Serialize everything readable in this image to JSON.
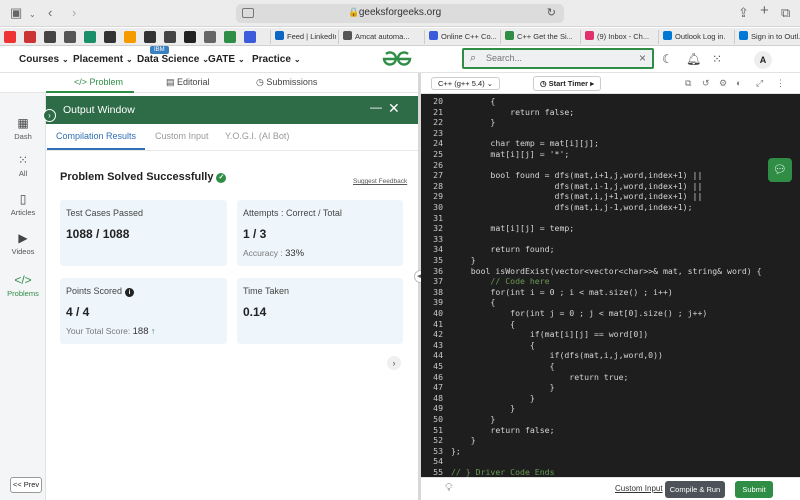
{
  "browser": {
    "url": "geeksforgeeks.org",
    "bookmarks": [
      {
        "label": "Feed | LinkedIn",
        "color": "#0a66c2"
      },
      {
        "label": "Amcat automa...",
        "color": "#555555"
      },
      {
        "label": "Online C++ Co...",
        "color": "#3b5bdb"
      },
      {
        "label": "C++ Get the Si...",
        "color": "#2f8d46"
      },
      {
        "label": "(9) Inbox - Ch...",
        "color": "#e1306c"
      },
      {
        "label": "Outlook Log in...",
        "color": "#0078d4"
      },
      {
        "label": "Sign in to Outl...",
        "color": "#0078d4"
      }
    ]
  },
  "header": {
    "nav": [
      {
        "label": "Courses"
      },
      {
        "label": "Placement"
      },
      {
        "label": "Data Science"
      },
      {
        "label": "GATE"
      },
      {
        "label": "Practice"
      }
    ],
    "badge": "IBM",
    "search_placeholder": "Search...",
    "avatar": "A"
  },
  "problem_tabs": {
    "problem": "Problem",
    "editorial": "Editorial",
    "submissions": "Submissions"
  },
  "sidebar": {
    "items": [
      {
        "label": "Dash"
      },
      {
        "label": "All"
      },
      {
        "label": "Articles"
      },
      {
        "label": "Videos"
      },
      {
        "label": "Problems"
      }
    ],
    "prev": "<< Prev"
  },
  "output": {
    "title": "Output Window",
    "tabs": [
      "Compilation Results",
      "Custom Input",
      "Y.O.G.I. (AI Bot)"
    ],
    "status": "Problem Solved Successfully",
    "suggest": "Suggest Feedback",
    "tests_label": "Test Cases Passed",
    "tests_value": "1088 / 1088",
    "attempts_label": "Attempts : Correct / Total",
    "attempts_value": "1 / 3",
    "accuracy_label": "Accuracy :",
    "accuracy_value": "33%",
    "points_label": "Points Scored",
    "points_value": "4 / 4",
    "total_label": "Your Total Score:",
    "total_value": "188",
    "time_label": "Time Taken",
    "time_value": "0.14"
  },
  "editor": {
    "language": "C++ (g++ 5.4)",
    "timer": "Start Timer",
    "custom_input": "Custom Input",
    "compile": "Compile & Run",
    "submit": "Submit",
    "lines": [
      {
        "n": "20",
        "t": "        {"
      },
      {
        "n": "21",
        "t": "            return false;"
      },
      {
        "n": "22",
        "t": "        }"
      },
      {
        "n": "23",
        "t": ""
      },
      {
        "n": "24",
        "t": "        char temp = mat[i][j];"
      },
      {
        "n": "25",
        "t": "        mat[i][j] = '*';"
      },
      {
        "n": "26",
        "t": ""
      },
      {
        "n": "27",
        "t": "        bool found = dfs(mat,i+1,j,word,index+1) ||"
      },
      {
        "n": "28",
        "t": "                     dfs(mat,i-1,j,word,index+1) ||"
      },
      {
        "n": "29",
        "t": "                     dfs(mat,i,j+1,word,index+1) ||"
      },
      {
        "n": "30",
        "t": "                     dfs(mat,i,j-1,word,index+1);"
      },
      {
        "n": "31",
        "t": ""
      },
      {
        "n": "32",
        "t": "        mat[i][j] = temp;"
      },
      {
        "n": "33",
        "t": ""
      },
      {
        "n": "34",
        "t": "        return found;"
      },
      {
        "n": "35",
        "t": "    }"
      },
      {
        "n": "36",
        "t": "    bool isWordExist(vector<vector<char>>& mat, string& word) {"
      },
      {
        "n": "37",
        "t": "        // Code here"
      },
      {
        "n": "38",
        "t": "        for(int i = 0 ; i < mat.size() ; i++)"
      },
      {
        "n": "39",
        "t": "        {"
      },
      {
        "n": "40",
        "t": "            for(int j = 0 ; j < mat[0].size() ; j++)"
      },
      {
        "n": "41",
        "t": "            {"
      },
      {
        "n": "42",
        "t": "                if(mat[i][j] == word[0])"
      },
      {
        "n": "43",
        "t": "                {"
      },
      {
        "n": "44",
        "t": "                    if(dfs(mat,i,j,word,0))"
      },
      {
        "n": "45",
        "t": "                    {"
      },
      {
        "n": "46",
        "t": "                        return true;"
      },
      {
        "n": "47",
        "t": "                    }"
      },
      {
        "n": "48",
        "t": "                }"
      },
      {
        "n": "49",
        "t": "            }"
      },
      {
        "n": "50",
        "t": "        }"
      },
      {
        "n": "51",
        "t": "        return false;"
      },
      {
        "n": "52",
        "t": "    }"
      },
      {
        "n": "53",
        "t": "};"
      },
      {
        "n": "54",
        "t": ""
      },
      {
        "n": "55",
        "t": "// } Driver Code Ends"
      }
    ]
  },
  "colors": {
    "accent": "#2f8d46",
    "header_green": "#2e6b47",
    "link_blue": "#2f6fb5"
  }
}
